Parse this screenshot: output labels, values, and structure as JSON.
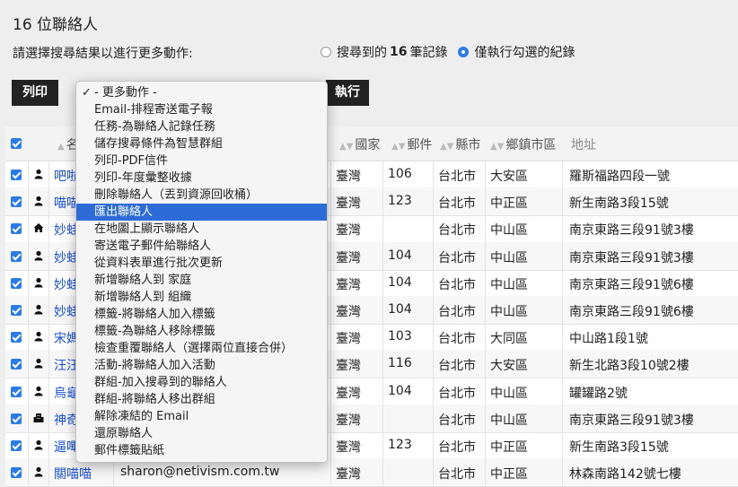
{
  "page": {
    "title": "16 位聯絡人",
    "subtitle": "請選擇搜尋結果以進行更多動作:"
  },
  "radios": [
    {
      "pre": "搜尋到的",
      "bold": "16",
      "post": "筆記錄",
      "selected": false
    },
    {
      "pre": "僅執行勾選的紀錄",
      "bold": "",
      "post": "",
      "selected": true
    }
  ],
  "buttons": {
    "print": "列印",
    "run": "執行"
  },
  "menu": {
    "selected_index": 7,
    "items": [
      "- 更多動作 -",
      "Email-排程寄送電子報",
      "任務-為聯絡人記錄任務",
      "儲存搜尋條件為智慧群組",
      "列印-PDF信件",
      "列印-年度彙整收據",
      "刪除聯絡人（丟到資源回收桶）",
      "匯出聯絡人",
      "在地圖上顯示聯絡人",
      "寄送電子郵件給聯絡人",
      "從資料表單進行批次更新",
      "新增聯絡人到 家庭",
      "新增聯絡人到 組織",
      "標籤-將聯絡人加入標籤",
      "標籤-為聯絡人移除標籤",
      "檢查重覆聯絡人（選擇兩位直接合併）",
      "活動-將聯絡人加入活動",
      "群組-加入搜尋到的聯絡人",
      "群組-將聯絡人移出群組",
      "解除凍結的 Email",
      "還原聯絡人",
      "郵件標籤貼紙"
    ]
  },
  "table": {
    "headers": {
      "name": "名",
      "country": "國家",
      "zip": "郵件",
      "city": "縣市",
      "district": "鄉鎮市區",
      "address": "地址"
    },
    "rows": [
      {
        "icon": "person-icon",
        "name": "吧啦",
        "email": "",
        "country": "臺灣",
        "zip": "106",
        "city": "台北市",
        "district": "大安區",
        "address": "羅斯福路四段一號"
      },
      {
        "icon": "person-icon",
        "name": "喵喵",
        "email": "",
        "country": "臺灣",
        "zip": "123",
        "city": "台北市",
        "district": "中正區",
        "address": "新生南路3段15號"
      },
      {
        "icon": "home-icon",
        "name": "妙蛙",
        "email": "",
        "country": "臺灣",
        "zip": "",
        "city": "台北市",
        "district": "中山區",
        "address": "南京東路三段91號3樓"
      },
      {
        "icon": "person-icon",
        "name": "妙蛙",
        "email": "",
        "country": "臺灣",
        "zip": "104",
        "city": "台北市",
        "district": "中山區",
        "address": "南京東路三段91號3樓"
      },
      {
        "icon": "person-icon",
        "name": "妙蛙",
        "email": "",
        "country": "臺灣",
        "zip": "104",
        "city": "台北市",
        "district": "中山區",
        "address": "南京東路三段91號6樓"
      },
      {
        "icon": "person-icon",
        "name": "妙蛙",
        "email": "",
        "country": "臺灣",
        "zip": "104",
        "city": "台北市",
        "district": "中山區",
        "address": "南京東路三段91號6樓"
      },
      {
        "icon": "person-icon",
        "name": "宋媽",
        "email": "",
        "country": "臺灣",
        "zip": "103",
        "city": "台北市",
        "district": "大同區",
        "address": "中山路1段1號"
      },
      {
        "icon": "person-icon",
        "name": "汪汪",
        "email": "",
        "country": "臺灣",
        "zip": "116",
        "city": "台北市",
        "district": "大安區",
        "address": "新生北路3段10號2樓"
      },
      {
        "icon": "person-icon",
        "name": "烏龜",
        "email": "",
        "country": "臺灣",
        "zip": "104",
        "city": "台北市",
        "district": "中山區",
        "address": "罐罐路2號"
      },
      {
        "icon": "building-icon",
        "name": "神奇",
        "email": "",
        "country": "臺灣",
        "zip": "",
        "city": "台北市",
        "district": "中山區",
        "address": "南京東路三段91號3樓"
      },
      {
        "icon": "person-icon",
        "name": "逼嗶",
        "email": "",
        "country": "臺灣",
        "zip": "123",
        "city": "台北市",
        "district": "中正區",
        "address": "新生南路3段15號"
      },
      {
        "icon": "person-icon",
        "name": "關喵喵",
        "email": "sharon@netivism.com.tw",
        "country": "臺灣",
        "zip": "",
        "city": "台北市",
        "district": "中正區",
        "address": "林森南路142號七樓"
      }
    ]
  }
}
